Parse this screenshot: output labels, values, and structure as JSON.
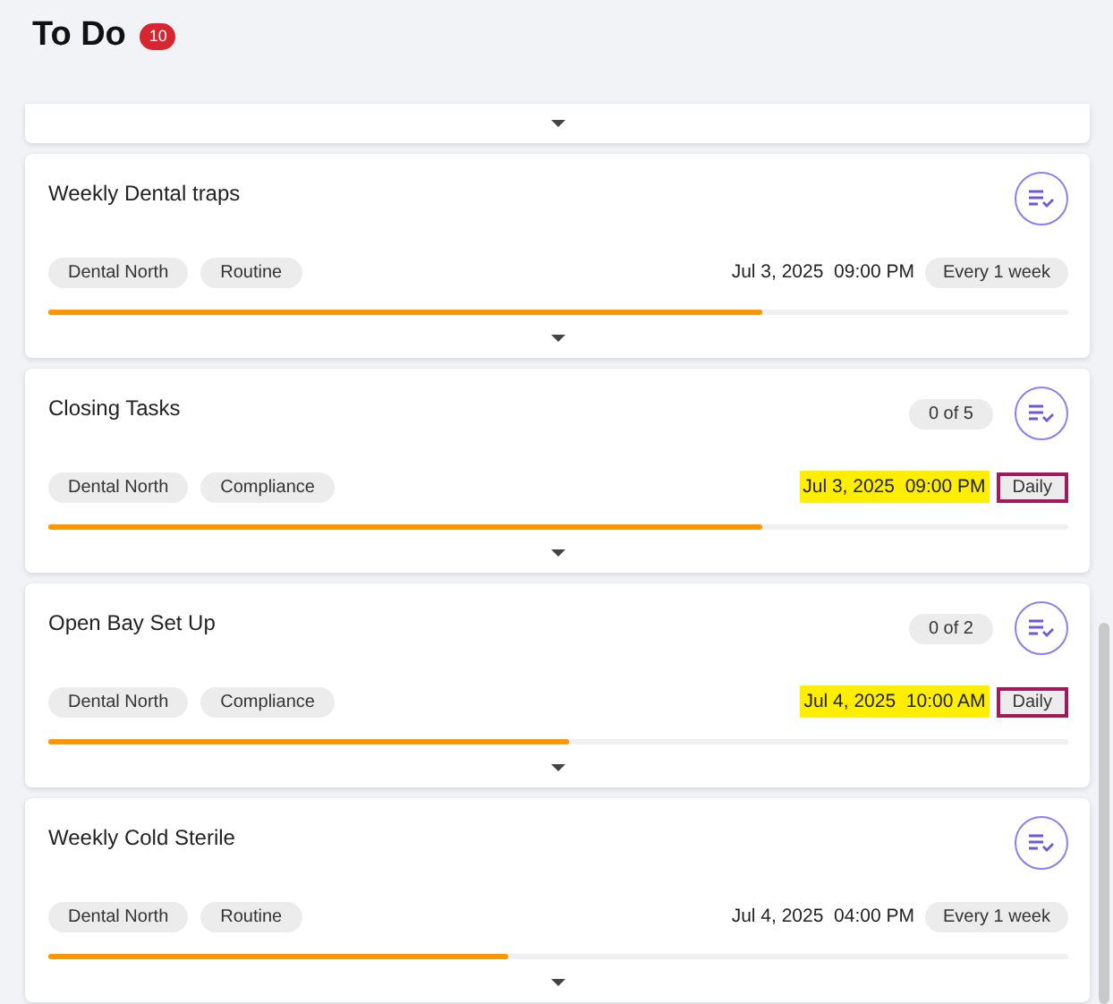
{
  "header": {
    "title": "To Do",
    "badge": "10"
  },
  "cards": [
    {
      "kind": "partial"
    },
    {
      "kind": "task",
      "title": "Weekly Dental traps",
      "tags": [
        "Dental North",
        "Routine"
      ],
      "date": "Jul 3, 2025  09:00 PM",
      "frequency": "Every 1 week",
      "highlighted": false,
      "level": 0.7
    },
    {
      "kind": "task",
      "title": "Closing Tasks",
      "count": "0 of 5",
      "tags": [
        "Dental North",
        "Compliance"
      ],
      "date": "Jul 3, 2025  09:00 PM",
      "frequency": "Daily",
      "highlighted": true,
      "level": 0.7
    },
    {
      "kind": "task",
      "title": "Open Bay Set Up",
      "count": "0 of 2",
      "tags": [
        "Dental North",
        "Compliance"
      ],
      "date": "Jul 4, 2025  10:00 AM",
      "frequency": "Daily",
      "highlighted": true,
      "level": 0.51
    },
    {
      "kind": "task",
      "title": "Weekly Cold Sterile",
      "tags": [
        "Dental North",
        "Routine"
      ],
      "date": "Jul 4, 2025  04:00 PM",
      "frequency": "Every 1 week",
      "highlighted": false,
      "level": 0.45
    }
  ]
}
